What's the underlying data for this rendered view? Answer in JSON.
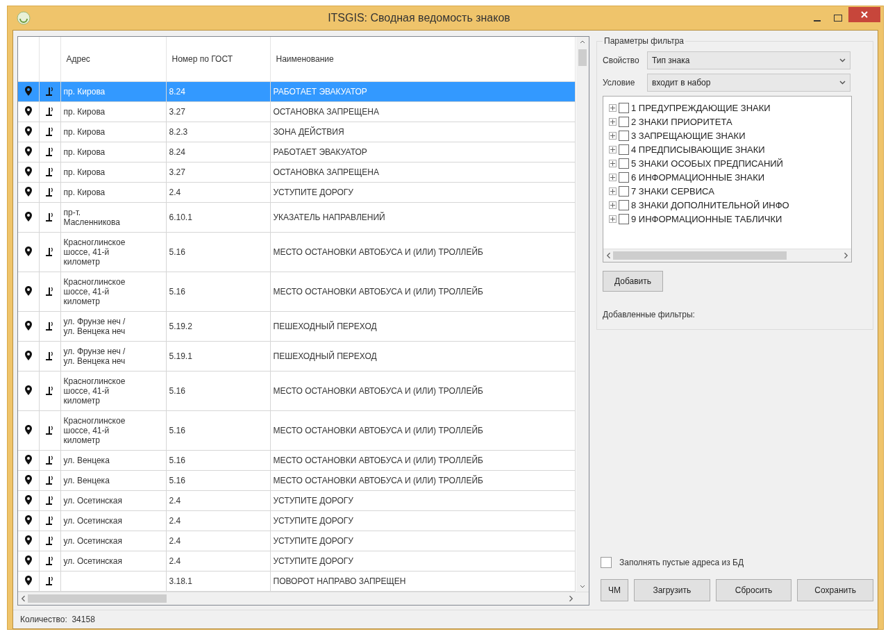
{
  "window": {
    "title": "ITSGIS: Сводная ведомость знаков"
  },
  "table": {
    "columns": [
      "Адрес",
      "Номер по ГОСТ",
      "Наименование"
    ],
    "rows": [
      {
        "address": "пр. Кирова",
        "gost": "8.24",
        "name": "РАБОТАЕТ ЭВАКУАТОР",
        "selected": true
      },
      {
        "address": "пр. Кирова",
        "gost": "3.27",
        "name": "ОСТАНОВКА ЗАПРЕЩЕНА",
        "selected": false
      },
      {
        "address": "пр. Кирова",
        "gost": "8.2.3",
        "name": "ЗОНА ДЕЙСТВИЯ",
        "selected": false
      },
      {
        "address": "пр. Кирова",
        "gost": "8.24",
        "name": "РАБОТАЕТ ЭВАКУАТОР",
        "selected": false
      },
      {
        "address": "пр. Кирова",
        "gost": "3.27",
        "name": "ОСТАНОВКА ЗАПРЕЩЕНА",
        "selected": false
      },
      {
        "address": "пр. Кирова",
        "gost": "2.4",
        "name": "УСТУПИТЕ ДОРОГУ",
        "selected": false
      },
      {
        "address": "пр-т. Масленникова",
        "gost": "6.10.1",
        "name": "УКАЗАТЕЛЬ НАПРАВЛЕНИЙ",
        "selected": false
      },
      {
        "address": "Красноглинское шоссе, 41-й километр",
        "gost": "5.16",
        "name": "МЕСТО ОСТАНОВКИ АВТОБУСА И (ИЛИ) ТРОЛЛЕЙБ",
        "selected": false
      },
      {
        "address": "Красноглинское шоссе, 41-й километр",
        "gost": "5.16",
        "name": "МЕСТО ОСТАНОВКИ АВТОБУСА И (ИЛИ) ТРОЛЛЕЙБ",
        "selected": false
      },
      {
        "address": "ул. Фрунзе неч / ул. Венцека неч",
        "gost": "5.19.2",
        "name": "ПЕШЕХОДНЫЙ ПЕРЕХОД",
        "selected": false
      },
      {
        "address": "ул. Фрунзе неч / ул. Венцека неч",
        "gost": "5.19.1",
        "name": "ПЕШЕХОДНЫЙ ПЕРЕХОД",
        "selected": false
      },
      {
        "address": "Красноглинское шоссе, 41-й километр",
        "gost": "5.16",
        "name": "МЕСТО ОСТАНОВКИ АВТОБУСА И (ИЛИ) ТРОЛЛЕЙБ",
        "selected": false
      },
      {
        "address": "Красноглинское шоссе, 41-й километр",
        "gost": "5.16",
        "name": "МЕСТО ОСТАНОВКИ АВТОБУСА И (ИЛИ) ТРОЛЛЕЙБ",
        "selected": false
      },
      {
        "address": "ул. Венцека",
        "gost": "5.16",
        "name": "МЕСТО ОСТАНОВКИ АВТОБУСА И (ИЛИ) ТРОЛЛЕЙБ",
        "selected": false
      },
      {
        "address": "ул. Венцека",
        "gost": "5.16",
        "name": "МЕСТО ОСТАНОВКИ АВТОБУСА И (ИЛИ) ТРОЛЛЕЙБ",
        "selected": false
      },
      {
        "address": "ул. Осетинская",
        "gost": "2.4",
        "name": "УСТУПИТЕ ДОРОГУ",
        "selected": false
      },
      {
        "address": "ул. Осетинская",
        "gost": "2.4",
        "name": "УСТУПИТЕ ДОРОГУ",
        "selected": false
      },
      {
        "address": "ул. Осетинская",
        "gost": "2.4",
        "name": "УСТУПИТЕ ДОРОГУ",
        "selected": false
      },
      {
        "address": "ул. Осетинская",
        "gost": "2.4",
        "name": "УСТУПИТЕ ДОРОГУ",
        "selected": false
      },
      {
        "gost": "3.18.1",
        "name": "ПОВОРОТ НАПРАВО ЗАПРЕЩЕН",
        "selected": false
      }
    ]
  },
  "filter": {
    "title": "Параметры фильтра",
    "property": {
      "label": "Свойство",
      "value": "Тип знака"
    },
    "condition": {
      "label": "Условие",
      "value": "входит в набор"
    },
    "tree": [
      {
        "label": "1 ПРЕДУПРЕЖДАЮЩИЕ ЗНАКИ",
        "checked": false,
        "expanded": false
      },
      {
        "label": "2 ЗНАКИ ПРИОРИТЕТА",
        "checked": false,
        "expanded": false
      },
      {
        "label": "3 ЗАПРЕЩАЮЩИЕ ЗНАКИ",
        "checked": false,
        "expanded": false
      },
      {
        "label": "4 ПРЕДПИСЫВАЮЩИЕ ЗНАКИ",
        "checked": false,
        "expanded": false
      },
      {
        "label": "5 ЗНАКИ ОСОБЫХ ПРЕДПИСАНИЙ",
        "checked": false,
        "expanded": false
      },
      {
        "label": "6 ИНФОРМАЦИОННЫЕ ЗНАКИ",
        "checked": false,
        "expanded": false
      },
      {
        "label": "7 ЗНАКИ СЕРВИСА",
        "checked": false,
        "expanded": false
      },
      {
        "label": "8 ЗНАКИ ДОПОЛНИТЕЛЬНОЙ ИНФО",
        "checked": false,
        "expanded": false
      },
      {
        "label": "9 ИНФОРМАЦИОННЫЕ ТАБЛИЧКИ",
        "checked": false,
        "expanded": false
      }
    ],
    "add_button": "Добавить",
    "added_filters_label": "Добавленные фильтры:"
  },
  "fill_empty": {
    "label": "Заполнять пустые адреса из БД",
    "checked": false
  },
  "buttons": [
    "ЧМ",
    "Загрузить",
    "Сбросить",
    "Сохранить"
  ],
  "status_bar": {
    "text": "Количество:  34158"
  }
}
